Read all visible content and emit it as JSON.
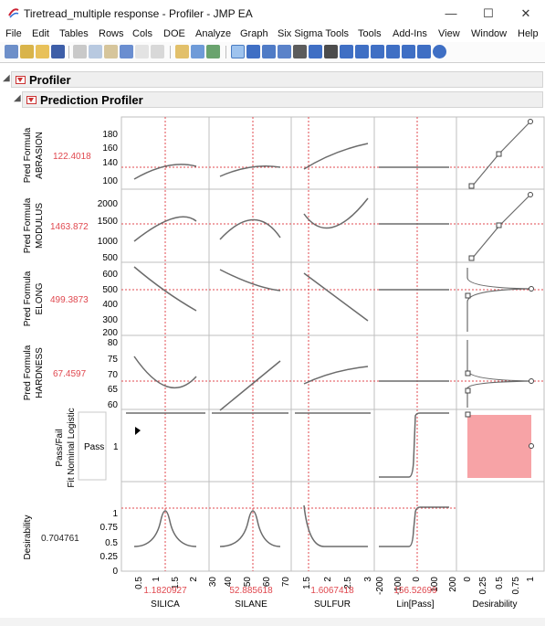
{
  "window": {
    "title": "Tiretread_multiple response - Profiler - JMP EA",
    "minimize": "—",
    "maximize": "☐",
    "close": "✕"
  },
  "menu": [
    "File",
    "Edit",
    "Tables",
    "Rows",
    "Cols",
    "DOE",
    "Analyze",
    "Graph",
    "Six Sigma Tools",
    "Tools",
    "Add-Ins",
    "View",
    "Window",
    "Help"
  ],
  "sections": {
    "profiler": "Profiler",
    "prediction_profiler": "Prediction Profiler"
  },
  "rows": [
    {
      "label1": "Pred Formula",
      "label2": "ABRASION",
      "value": "122.4018",
      "ticks": [
        "180",
        "160",
        "140",
        "100"
      ]
    },
    {
      "label1": "Pred Formula",
      "label2": "MODULUS",
      "value": "1463.872",
      "ticks": [
        "2000",
        "1500",
        "1000",
        "500"
      ]
    },
    {
      "label1": "Pred Formula",
      "label2": "ELONG",
      "value": "499.3873",
      "ticks": [
        "600",
        "500",
        "400",
        "300",
        "200"
      ]
    },
    {
      "label1": "Pred Formula",
      "label2": "HARDNESS",
      "value": "67.4597",
      "ticks": [
        "80",
        "75",
        "70",
        "65",
        "60"
      ]
    },
    {
      "label1": "Pass/Fail",
      "label2": "Fit Nominal Logistic",
      "level": "Pass",
      "level_tick": "1"
    },
    {
      "label1": "Desirability",
      "value": "0.704761",
      "ticks": [
        "1",
        "0.75",
        "0.5",
        "0.25",
        "0"
      ]
    }
  ],
  "factors": [
    {
      "name": "SILICA",
      "value": "1.1820927",
      "ticks": [
        "0.5",
        "1",
        "1.5",
        "2"
      ]
    },
    {
      "name": "SILANE",
      "value": "52.885618",
      "ticks": [
        "40",
        "50",
        "60",
        "70"
      ],
      "extra_tick": "30"
    },
    {
      "name": "SULFUR",
      "value": "1.6067418",
      "ticks": [
        "1.5",
        "2",
        "2.5",
        "3"
      ]
    },
    {
      "name": "Lin[Pass]",
      "value": "156.52699",
      "ticks": [
        "-200",
        "-100",
        "0",
        "100",
        "200"
      ]
    },
    {
      "name": "Desirability",
      "ticks": [
        "0",
        "0.25",
        "0.5",
        "0.75",
        "1"
      ]
    }
  ],
  "colors": {
    "accent_red": "#e0484f",
    "curve": "#6b6b6b",
    "pass_fill": "#f7a3a6"
  }
}
